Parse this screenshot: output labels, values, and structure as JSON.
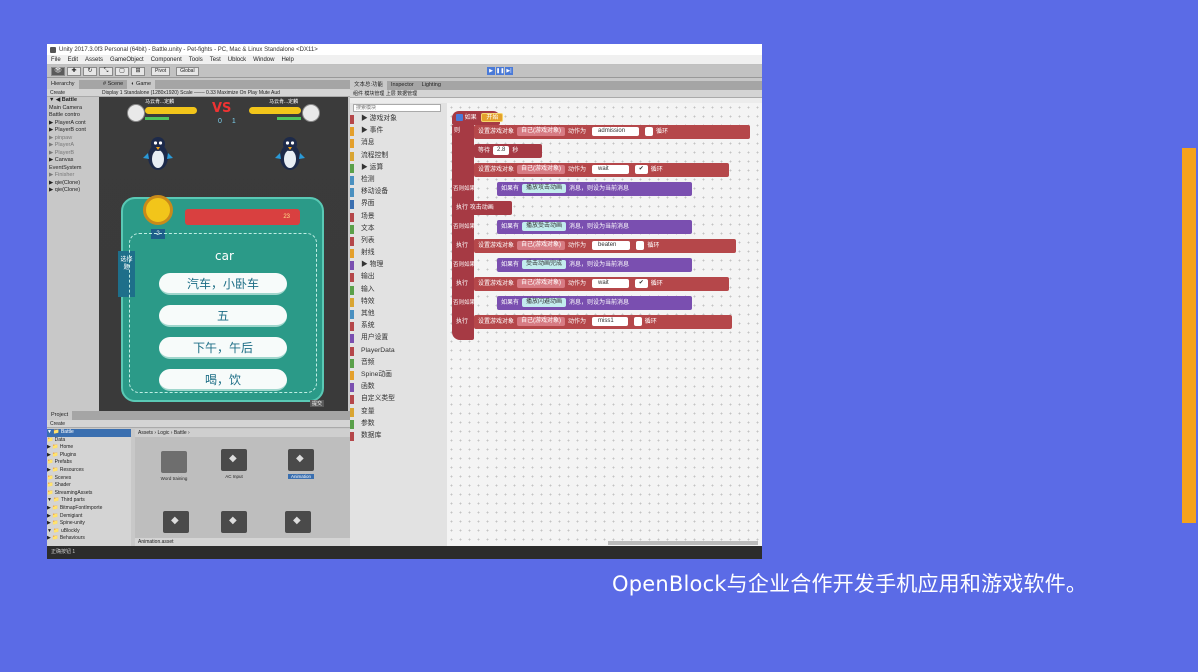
{
  "caption": "OpenBlock与企业合作开发手机应用和游戏软件。",
  "unity": {
    "title": "Unity 2017.3.0f3 Personal (64bit) - Battle.unity - Pet-fights - PC, Mac & Linux Standalone <DX11>",
    "menus": [
      "File",
      "Edit",
      "Assets",
      "GameObject",
      "Component",
      "Tools",
      "Test",
      "Ublock",
      "Window",
      "Help"
    ],
    "toolbar": {
      "pivot": "Pivot",
      "global": "Global"
    },
    "hierarchy": {
      "tab": "Hierarchy",
      "create": "Create",
      "items": [
        {
          "text": "▼ ◀ Battle",
          "style": "bold"
        },
        {
          "text": "   Main Camera",
          "style": ""
        },
        {
          "text": "   Battle contro",
          "style": ""
        },
        {
          "text": " ▶ PlayerA cont",
          "style": ""
        },
        {
          "text": " ▶ PlayerB cont",
          "style": ""
        },
        {
          "text": " ▶ pinpaw",
          "style": "dim"
        },
        {
          "text": " ▶ PlayerA",
          "style": "dim"
        },
        {
          "text": " ▶ PlayerB",
          "style": "dim"
        },
        {
          "text": " ▶ Canvas",
          "style": ""
        },
        {
          "text": "   EventSystem",
          "style": ""
        },
        {
          "text": " ▶ Finisher",
          "style": "dim"
        },
        {
          "text": " ▶ qie(Clone)",
          "style": ""
        },
        {
          "text": " ▶ qie(Clone)",
          "style": ""
        }
      ]
    },
    "game_tabs": [
      "# Scene",
      "◐ Game"
    ],
    "game_sub": "Display 1   Standalone (1280x1920)   Scale ─── 0.33   Maximize On Play  Mute Aud",
    "game": {
      "player_left": "马云肯...定麟",
      "player_right": "马云肯...定麟",
      "vs": "VS",
      "score": "0 1",
      "stars": "23",
      "level": "2",
      "side_tab": "选择题",
      "word": "car",
      "options": [
        "汽车，小卧车",
        "五",
        "下午，午后",
        "喝，饮"
      ],
      "footer": "提交"
    },
    "block_tabs": [
      "文本总:功能",
      "Inspector",
      "Lighting"
    ],
    "block_subtabs": "组件  模块管理  上层  数据管理",
    "search_placeholder": "搜索模块",
    "categories": [
      {
        "label": "▶ 游戏对象",
        "color": "#b5474a"
      },
      {
        "label": "▶ 事件",
        "color": "#e4a02c"
      },
      {
        "label": "消息",
        "color": "#e4a02c"
      },
      {
        "label": "流程控制",
        "color": "#d9a532"
      },
      {
        "label": "▶ 运算",
        "color": "#5aa04a"
      },
      {
        "label": "检测",
        "color": "#4a90c0"
      },
      {
        "label": "移动设备",
        "color": "#4a90c0"
      },
      {
        "label": "界面",
        "color": "#3a6fb0"
      },
      {
        "label": "场景",
        "color": "#b5474a"
      },
      {
        "label": "文本",
        "color": "#5aa04a"
      },
      {
        "label": "列表",
        "color": "#b5474a"
      },
      {
        "label": "射线",
        "color": "#e4a02c"
      },
      {
        "label": "▶ 物理",
        "color": "#7a4fb0"
      },
      {
        "label": "输出",
        "color": "#b5474a"
      },
      {
        "label": "输入",
        "color": "#5aa04a"
      },
      {
        "label": "特效",
        "color": "#d9a532"
      },
      {
        "label": "其他",
        "color": "#4a90c0"
      },
      {
        "label": "系统",
        "color": "#b5474a"
      },
      {
        "label": "用户设置",
        "color": "#7a4fb0"
      },
      {
        "label": "PlayerData",
        "color": "#b5474a"
      },
      {
        "label": "音频",
        "color": "#5aa04a"
      },
      {
        "label": "Spine动画",
        "color": "#e4a02c"
      },
      {
        "label": "函数",
        "color": "#7a4fb0"
      },
      {
        "label": "自定义类型",
        "color": "#b5474a"
      },
      {
        "label": "变量",
        "color": "#d9a532"
      },
      {
        "label": "参数",
        "color": "#5aa04a"
      },
      {
        "label": "数据库",
        "color": "#b5474a"
      }
    ],
    "blocks": {
      "if": "如果",
      "start": "开始",
      "then": "则",
      "set_obj": "设置游戏对象",
      "self_obj": "自己(游戏对象)",
      "anim_is": "动作为",
      "loop": "循环",
      "wait": "等待",
      "wait_val": "2.8",
      "seconds": "秒",
      "else_if": "否则如果",
      "has": "如果有",
      "msg_suffix": "消息，则设为当前消息",
      "exec": "执行",
      "attack": "攻击动画",
      "msg1": "播放攻击动画",
      "msg2": "播放受击动画",
      "msg3": "受击动画完成",
      "msg4": "播放闪避动画",
      "admission": "admission",
      "wait_anim": "wait",
      "beaten": "beaten",
      "miss": "miss1"
    },
    "project": {
      "tab": "Project",
      "create": "Create",
      "breadcrumb": "Assets › Logic › Battle ›",
      "tree": [
        "▼ 📁 Battle",
        "   📁 Data",
        "  ▶ 📁 Home",
        "▶ 📁 Plugins",
        "   📁 Prefabs",
        "▶ 📁 Resources",
        "   📁 Scenes",
        "   📁 Shader",
        "   📁 StreamingAssets",
        "▼ 📁 Third parts",
        "  ▶ 📁 BitmapFontImporte",
        "  ▶ 📁 Demigiant",
        "  ▶ 📁 Spine-unity",
        "  ▼ 📁 uBlockly",
        "    ▶ 📁 Behaviours"
      ],
      "assets": [
        "Word training",
        "AC Input",
        "Animation",
        "",
        "",
        ""
      ],
      "footer_asset": "Animation.asset"
    },
    "status": "正确按钮 1"
  }
}
